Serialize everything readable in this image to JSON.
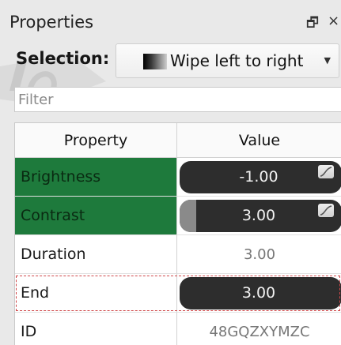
{
  "panel": {
    "title": "Properties",
    "float_icon": "float-window-icon",
    "close_icon": "close-icon"
  },
  "selection": {
    "label": "Selection:",
    "value": "Wipe left to right"
  },
  "filter": {
    "placeholder": "Filter"
  },
  "table": {
    "headers": [
      "Property",
      "Value"
    ],
    "rows": [
      {
        "name": "Brightness",
        "value": "-1.00",
        "active": true,
        "editable": true,
        "keyframe_icon": "keyframe-curve-icon",
        "level": 0
      },
      {
        "name": "Contrast",
        "value": "3.00",
        "active": true,
        "editable": true,
        "keyframe_icon": "keyframe-curve-icon",
        "level": 0.1
      },
      {
        "name": "Duration",
        "value": "3.00",
        "active": false,
        "editable": false
      },
      {
        "name": "End",
        "value": "3.00",
        "active": false,
        "editable": true
      },
      {
        "name": "ID",
        "value": "48GQZXYMZC",
        "active": false,
        "editable": false
      }
    ]
  },
  "colors": {
    "active_row": "#1e7a3c",
    "pill_bg": "#2d2d2d",
    "focus_outline": "#d0484a"
  }
}
